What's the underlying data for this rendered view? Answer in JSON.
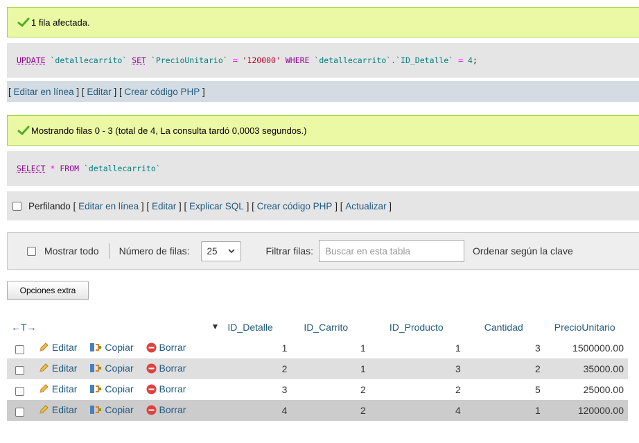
{
  "update_message": {
    "text": "1 fila afectada.",
    "sql_keyword_update": "UPDATE",
    "sql_table": "`detallecarrito`",
    "sql_keyword_set": "SET",
    "sql_column": "`PrecioUnitario`",
    "sql_eq": "=",
    "sql_value": "'120000'",
    "sql_keyword_where": "WHERE",
    "sql_where_lhs": "`detallecarrito`.`ID_Detalle`",
    "sql_eq2": "=",
    "sql_where_value": "4",
    "sql_end": ";"
  },
  "update_tools": {
    "open1": "[",
    "inline_edit": "Editar en línea",
    "close_open1": "] [",
    "edit": "Editar",
    "close_open2": "] [",
    "php": "Crear código PHP",
    "close": "]"
  },
  "select_message": {
    "text": "Mostrando filas 0 - 3 (total de 4, La consulta tardó 0,0003 segundos.)",
    "sql_keyword_select": "SELECT",
    "sql_star": "*",
    "sql_keyword_from": "FROM",
    "sql_table": "`detallecarrito`"
  },
  "profiling": {
    "label": "Perfilando",
    "o1": "[",
    "inline_edit": "Editar en línea",
    "sep1": "] [",
    "edit": "Editar",
    "sep2": "] [",
    "explain": "Explicar SQL",
    "sep3": "] [",
    "php": "Crear código PHP",
    "sep4": "] [",
    "refresh": "Actualizar",
    "c": "]"
  },
  "navigation": {
    "show_all": "Mostrar todo",
    "rows_label": "Número de filas:",
    "rows_value": "25",
    "filter_label": "Filtrar filas:",
    "filter_placeholder": "Buscar en esta tabla",
    "sort_label": "Ordenar según la clave"
  },
  "extra_options": "Opciones extra",
  "table": {
    "arrows": "←T→",
    "sort_indicator": "▼",
    "columns": [
      "ID_Detalle",
      "ID_Carrito",
      "ID_Producto",
      "Cantidad",
      "PrecioUnitario"
    ],
    "actions": {
      "edit": "Editar",
      "copy": "Copiar",
      "delete": "Borrar"
    },
    "rows": [
      {
        "ID_Detalle": "1",
        "ID_Carrito": "1",
        "ID_Producto": "1",
        "Cantidad": "3",
        "PrecioUnitario": "1500000.00"
      },
      {
        "ID_Detalle": "2",
        "ID_Carrito": "1",
        "ID_Producto": "3",
        "Cantidad": "2",
        "PrecioUnitario": "35000.00"
      },
      {
        "ID_Detalle": "3",
        "ID_Carrito": "2",
        "ID_Producto": "2",
        "Cantidad": "5",
        "PrecioUnitario": "25000.00"
      },
      {
        "ID_Detalle": "4",
        "ID_Carrito": "2",
        "ID_Producto": "4",
        "Cantidad": "1",
        "PrecioUnitario": "120000.00"
      }
    ]
  },
  "colors": {
    "success_bg": "#ebf8a4",
    "success_border": "#a2d246",
    "link": "#235a81",
    "sql_keyword": "#990099",
    "sql_string": "#c3002e"
  },
  "icons": {
    "success": "check-icon",
    "edit": "pencil-icon",
    "copy": "copy-icon",
    "delete": "delete-icon"
  }
}
